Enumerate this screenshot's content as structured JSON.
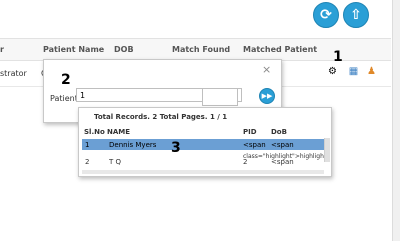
{
  "header": {
    "refresh_icon": "refresh-icon",
    "home_icon": "home-icon"
  },
  "grid": {
    "columns": [
      "Patient Name",
      "DOB",
      "Match Found",
      "Matched Patient"
    ],
    "first_col_cut": "r",
    "row_fragment": "strator",
    "row_fragment2": "C"
  },
  "markers": {
    "one": "1",
    "two": "2",
    "three": "3"
  },
  "modal": {
    "close": "×",
    "label": "Patient",
    "input_value": "1"
  },
  "results": {
    "summary": "Total Records. 2   Total Pages. 1 / 1",
    "headers": [
      "Sl.No",
      "NAME",
      "PID",
      "DoB"
    ],
    "rows": [
      {
        "sl": "1",
        "name": "Dennis Myers",
        "pid": "<span",
        "dob": "<span",
        "extra": "class=\"highlight\">highlight"
      },
      {
        "sl": "2",
        "name": "T Q",
        "pid": "2",
        "dob": "<span"
      }
    ]
  },
  "icons": {
    "fingerprint": "fingerprint-icon",
    "calendar": "calendar-icon",
    "user": "user-icon"
  }
}
